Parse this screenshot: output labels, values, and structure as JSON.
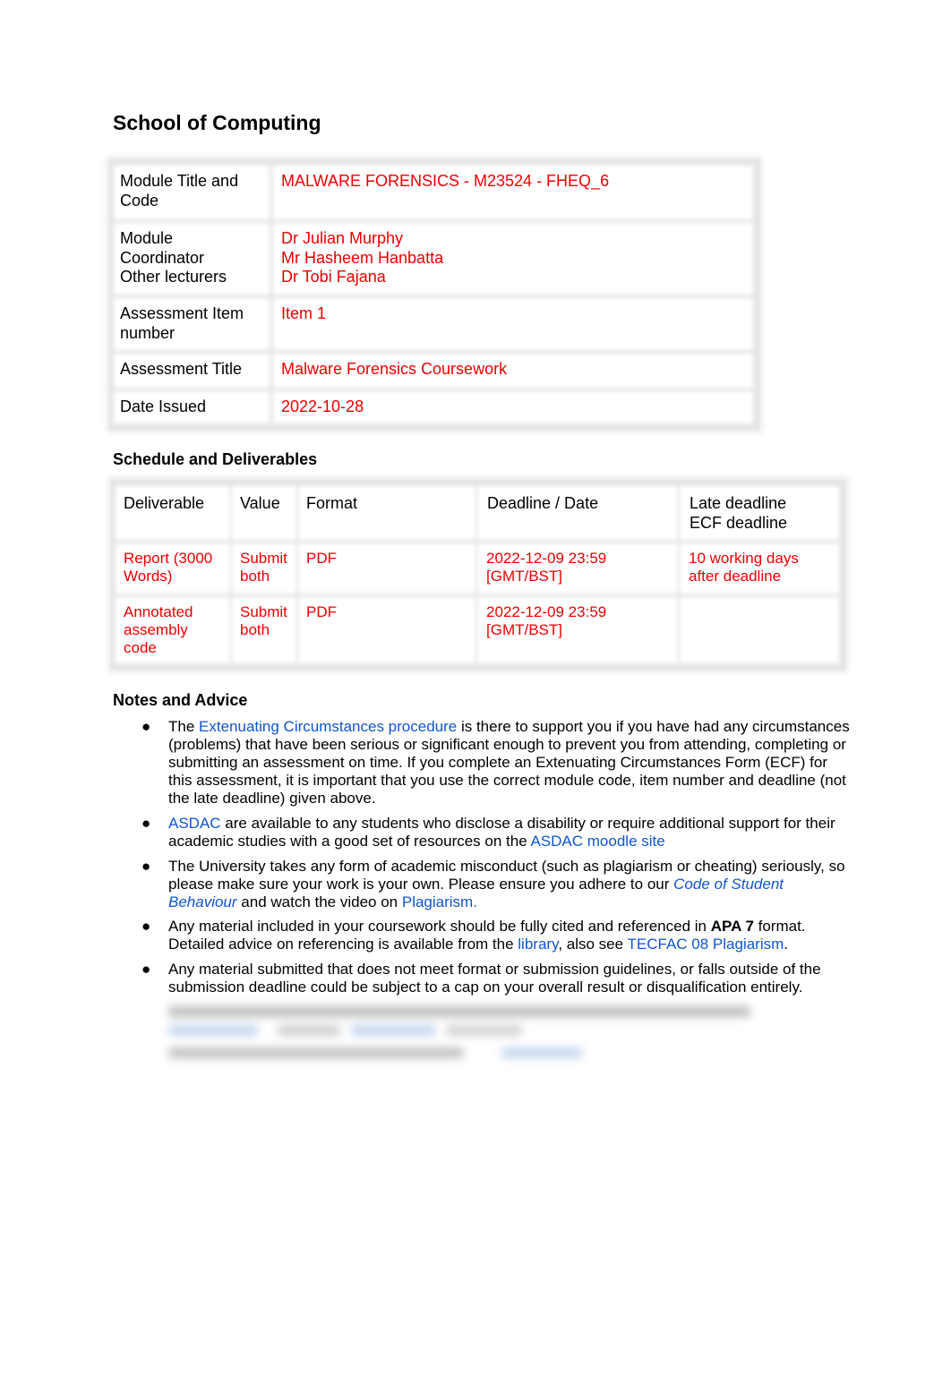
{
  "document": {
    "title": "School of Computing"
  },
  "info_table": {
    "rows": [
      {
        "label": "Module Title and Code",
        "value_lines": [
          "MALWARE FORENSICS - M23524 - FHEQ_6"
        ]
      },
      {
        "label": "Module Coordinator Other lecturers",
        "value_lines": [
          "Dr Julian Murphy",
          "Mr Hasheem Hanbatta",
          "Dr Tobi Fajana"
        ]
      },
      {
        "label": "Assessment Item number",
        "value_lines": [
          "Item 1"
        ]
      },
      {
        "label": "Assessment Title",
        "value_lines": [
          "Malware Forensics Coursework"
        ]
      },
      {
        "label": "Date Issued",
        "value_lines": [
          "2022-10-28"
        ]
      }
    ],
    "labels": {
      "r0a": "Module Title and",
      "r0b": "Code",
      "r1a": "Module",
      "r1b": "Coordinator",
      "r1c": "Other lecturers",
      "r2a": "Assessment Item",
      "r2b": "number",
      "r3a": "Assessment Title",
      "r4a": "Date Issued"
    },
    "values": {
      "r0": "MALWARE FORENSICS - M23524 - FHEQ_6",
      "r1a": "Dr Julian Murphy",
      "r1b": "Mr Hasheem Hanbatta",
      "r1c": "Dr Tobi Fajana",
      "r2": "Item 1",
      "r3": "Malware Forensics Coursework",
      "r4": "2022-10-28"
    }
  },
  "schedule": {
    "heading": "Schedule and Deliverables",
    "headers": {
      "deliverable": "Deliverable",
      "value": "Value",
      "format": "Format",
      "deadline": "Deadline / Date",
      "late_a": "Late deadline",
      "late_b": "ECF deadline"
    },
    "rows": [
      {
        "deliverable_a": "Report (3000",
        "deliverable_b": "Words)",
        "deliverable_c": "",
        "value_a": "Submit",
        "value_b": "both",
        "format": "PDF",
        "deadline_a": "2022-12-09 23:59",
        "deadline_b": "[GMT/BST]",
        "late_a": "10 working days",
        "late_b": "after deadline"
      },
      {
        "deliverable_a": "Annotated",
        "deliverable_b": "assembly",
        "deliverable_c": "code",
        "value_a": "Submit",
        "value_b": "both",
        "format": "PDF",
        "deadline_a": "2022-12-09 23:59",
        "deadline_b": "[GMT/BST]",
        "late_a": "",
        "late_b": ""
      }
    ]
  },
  "notes": {
    "heading": "Notes and Advice",
    "bullet": "●",
    "n0": {
      "pre": "The ",
      "link": "Extenuating Circumstances procedure",
      "post": " is there to support you if you have had any circumstances (problems) that have been serious or significant enough to prevent you from attending, completing or submitting an assessment on time. If you complete an Extenuating Circumstances Form (ECF) for this assessment, it is important that you use the correct module code, item number and deadline (not the late deadline) given above."
    },
    "n1": {
      "link1": "ASDAC",
      "mid": " are available to any students who disclose a disability or require additional support for their academic studies with a good set of resources on the ",
      "link2": "ASDAC moodle site"
    },
    "n2": {
      "pre": "The University takes any form of academic misconduct (such as plagiarism or cheating) seriously, so please make sure your work is your own. Please ensure you adhere to our ",
      "link1": "Code of Student Behaviour",
      "mid": " and watch the video on ",
      "link2": "Plagiarism."
    },
    "n3": {
      "pre": "Any material included in your coursework should be fully cited and referenced in ",
      "bold": "APA 7",
      "mid": " format. Detailed advice on referencing is available from the ",
      "link1": "library",
      "mid2": ", also see ",
      "link2": "TECFAC 08 Plagiarism",
      "post": "."
    },
    "n4": {
      "text": "Any material submitted that does not meet format or submission guidelines, or falls outside of the submission deadline could be subject to a cap on your overall result or disqualification entirely."
    }
  },
  "colors": {
    "value_red": "#ee0000",
    "link_blue": "#1155cc"
  }
}
